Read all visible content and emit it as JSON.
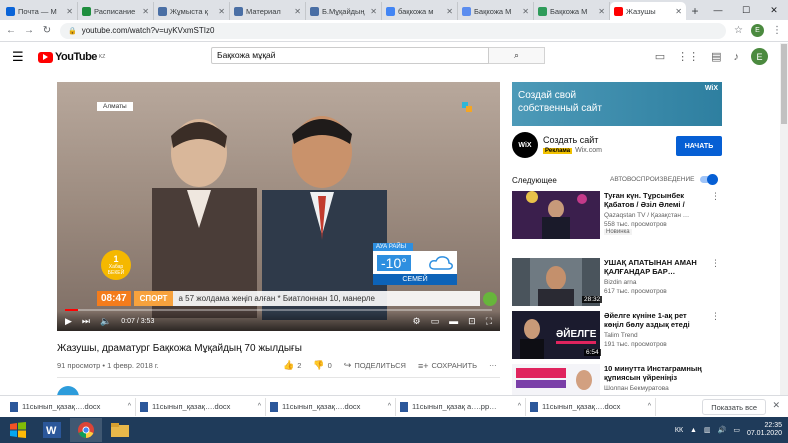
{
  "browser": {
    "tabs": [
      {
        "label": "Почта — М",
        "color": "#0a64d8"
      },
      {
        "label": "Расписание",
        "color": "#1e8e3e"
      },
      {
        "label": "Жұмыста қ",
        "color": "#4a6fa5"
      },
      {
        "label": "Материал",
        "color": "#4a6fa5"
      },
      {
        "label": "Б.Мұқайдың",
        "color": "#4a6fa5"
      },
      {
        "label": "бақкожа м",
        "color": "#4285f4"
      },
      {
        "label": "Бақкожа М",
        "color": "#5b8def"
      },
      {
        "label": "Бақкожа М",
        "color": "#2e9b5a"
      },
      {
        "label": "Жазушы",
        "color": "#ff0000"
      }
    ],
    "new_tab_symbol": "+",
    "url": "youtube.com/watch?v=uyKVxmSTIz0"
  },
  "youtube": {
    "logo_text": "YouTube",
    "country_code": "KZ",
    "search_value": "Бақкожа мұқай",
    "avatar_letter": "E",
    "player": {
      "location_badge": "Алматы",
      "weather_header": "АУА РАЙЫ",
      "temperature": "-10°",
      "city": "СЕМЕЙ",
      "badge_line1": "1",
      "badge_line2": "Хабар",
      "badge_line3": "БЕКЕЙ",
      "broadcast_time": "08:47",
      "sport_label": "СПОРТ",
      "ticker_text": "а 57 жолдама жеңіп алған *   Биатлоннан 10, манерле",
      "current_time": "0:07",
      "duration": "3:53",
      "progress_fraction": 0.03
    },
    "video": {
      "title": "Жазушы, драматург Бақкожа Мұқайдың 70 жылдығы",
      "meta": "91 просмотр • 1 февр. 2018 г.",
      "likes": "2",
      "dislikes": "0",
      "share_label": "ПОДЕЛИТЬСЯ",
      "save_label": "СОХРАНИТЬ"
    },
    "ad": {
      "banner_text": "Создай свой собственный сайт",
      "banner_logo": "WiX",
      "logo_text": "WiX",
      "title": "Создать сайт",
      "tag": "Реклама",
      "domain": "Wix.com",
      "button": "НАЧАТЬ"
    },
    "up_next_label": "Следующее",
    "autoplay_label": "АВТОВОСПРОИЗВЕДЕНИЕ",
    "recommendations": [
      {
        "title": "Туған күн. Тұрсынбек Қабатов / Әзіл Әлемі / Әзіл…",
        "channel": "Qazaqstan TV / Қазақстан …",
        "views": "558 тыс. просмотров",
        "badge": "Новинка",
        "duration": ""
      },
      {
        "title": "УШАҚ АПАТЫНАН АМАН ҚАЛҒАНДАР БАР…",
        "channel": "Bizdin arna",
        "views": "617 тыс. просмотров",
        "badge": "",
        "duration": "28:32"
      },
      {
        "title": "Әйелге күніне 1-ақ рет көңіл бөлу аздық етеді",
        "channel": "Talim Trend",
        "views": "191 тыс. просмотров",
        "badge": "",
        "duration": "6:54"
      },
      {
        "title": "10 минутта Инстаграмның құпиясын үйреніңіз",
        "channel": "Шолпан Бекмуратова",
        "views": "",
        "badge": "",
        "duration": ""
      }
    ]
  },
  "downloads": {
    "items": [
      "11сынып_қазақ….docx",
      "11сынып_қазақ….docx",
      "11сынып_қазақ….docx",
      "11сынып_қазақ а….pp…",
      "11сынып_қазақ….docx"
    ],
    "show_all": "Показать все"
  },
  "taskbar": {
    "lang": "КК",
    "time": "22:35",
    "date": "07.01.2020"
  }
}
